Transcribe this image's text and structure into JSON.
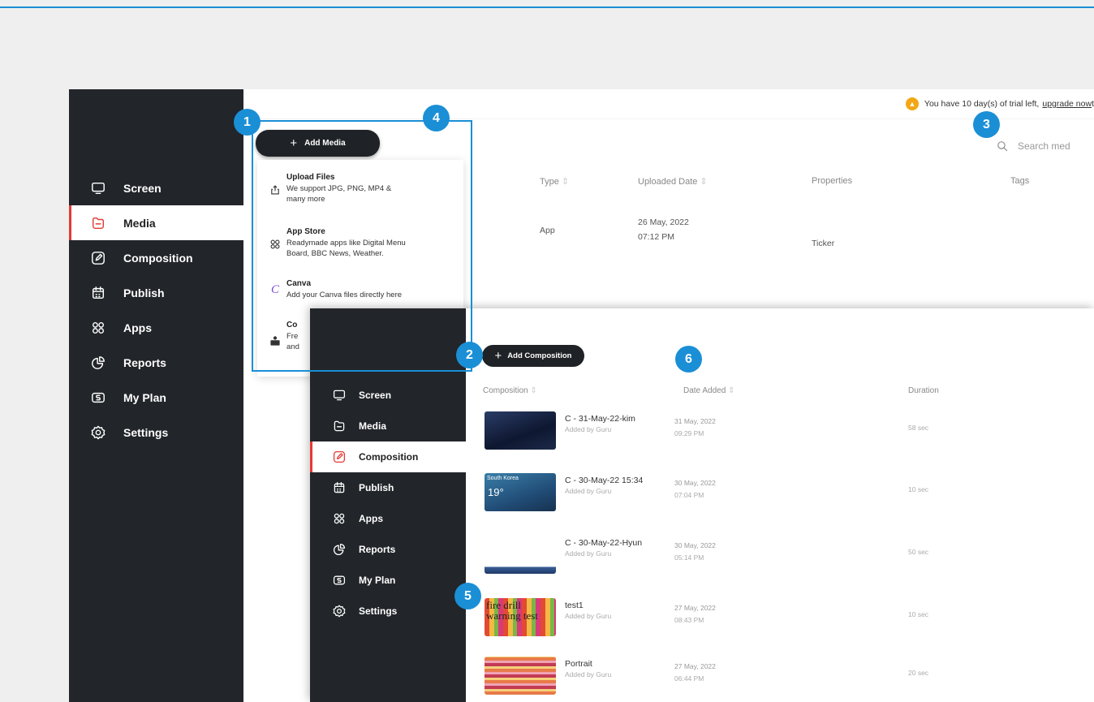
{
  "nav": [
    {
      "label": "Screen",
      "icon": "monitor-icon"
    },
    {
      "label": "Media",
      "icon": "folder-icon"
    },
    {
      "label": "Composition",
      "icon": "pencil-icon"
    },
    {
      "label": "Publish",
      "icon": "calendar-icon"
    },
    {
      "label": "Apps",
      "icon": "apps-grid-icon"
    },
    {
      "label": "Reports",
      "icon": "pie-chart-icon"
    },
    {
      "label": "My Plan",
      "icon": "plan-dollar-icon"
    },
    {
      "label": "Settings",
      "icon": "gear-icon"
    }
  ],
  "media": {
    "active_nav": "Media",
    "trial": {
      "prefix": "You have 10 day(s) of trial left,",
      "link": "upgrade now",
      "suffix": "t"
    },
    "search_placeholder": "Search med",
    "add_button": "Add Media",
    "columns": {
      "type": "Type",
      "uploaded": "Uploaded Date",
      "properties": "Properties",
      "tags": "Tags"
    },
    "rows": [
      {
        "type": "App",
        "date": "26 May, 2022",
        "time": "07:12 PM",
        "properties": "Ticker",
        "tags": ""
      }
    ],
    "dropdown": [
      {
        "title": "Upload Files",
        "desc1": "We support JPG, PNG, MP4 &",
        "desc2": "many more",
        "icon": "upload-icon"
      },
      {
        "title": "App Store",
        "desc1": "Readymade apps like Digital Menu",
        "desc2": "Board, BBC News, Weather.",
        "icon": "apps-grid-icon"
      },
      {
        "title": "Canva",
        "desc1": "Add your Canva files directly here",
        "desc2": "",
        "icon": "canva-icon"
      },
      {
        "title": "Co",
        "desc1": "Fre",
        "desc2": "and",
        "icon": "copy-icon"
      }
    ]
  },
  "composition": {
    "active_nav": "Composition",
    "add_button": "Add Composition",
    "columns": {
      "composition": "Composition",
      "date_added": "Date Added",
      "duration": "Duration"
    },
    "rows": [
      {
        "name": "C - 31-May-22-kim",
        "added_by": "Added by Guru",
        "date": "31 May, 2022",
        "time": "09:29 PM",
        "duration": "58 sec"
      },
      {
        "name": "C - 30-May-22 15:34",
        "added_by": "Added by Guru",
        "date": "30 May, 2022",
        "time": "07:04 PM",
        "duration": "10 sec",
        "thumb_label": "South Korea",
        "thumb_temp": "19°"
      },
      {
        "name": "C - 30-May-22-Hyun",
        "added_by": "Added by Guru",
        "date": "30 May, 2022",
        "time": "05:14 PM",
        "duration": "50 sec"
      },
      {
        "name": "test1",
        "added_by": "Added by Guru",
        "date": "27 May, 2022",
        "time": "08:43 PM",
        "duration": "10 sec",
        "thumb_text": "fire drill warning test"
      },
      {
        "name": "Portrait",
        "added_by": "Added by Guru",
        "date": "27 May, 2022",
        "time": "06:44 PM",
        "duration": "20 sec"
      }
    ]
  },
  "callouts": [
    "1",
    "2",
    "3",
    "4",
    "5",
    "6"
  ],
  "colors": {
    "accent": "#1a8fd6",
    "sidebar": "#222529",
    "active_marker": "#e53935",
    "warning": "#f2a714"
  }
}
